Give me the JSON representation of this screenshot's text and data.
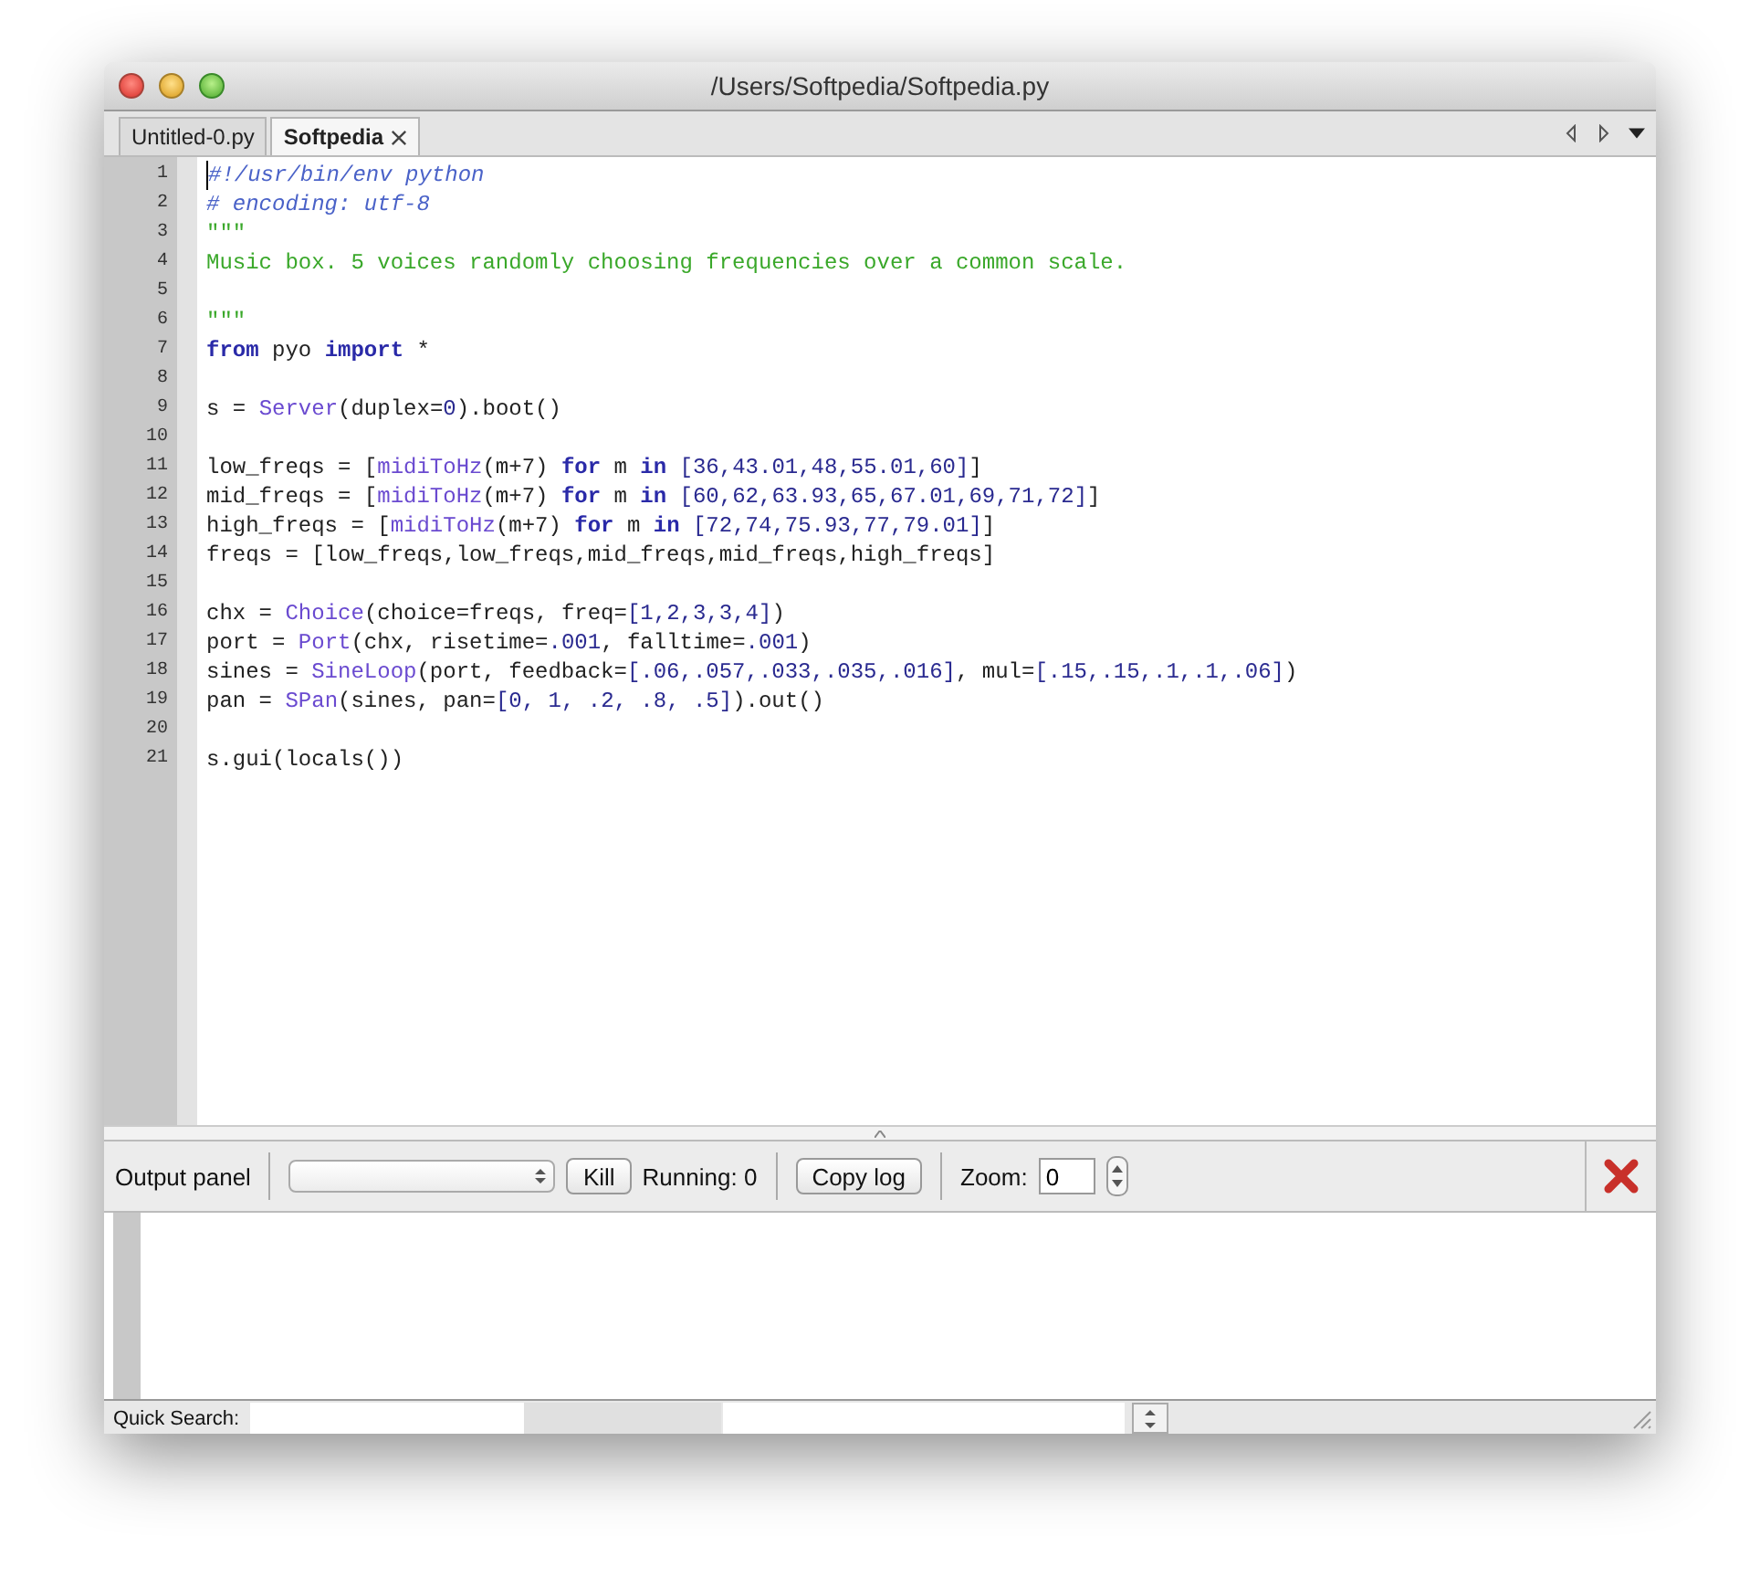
{
  "window": {
    "title": "/Users/Softpedia/Softpedia.py"
  },
  "tabs": [
    {
      "label": "Untitled-0.py",
      "selected": false,
      "closable": false
    },
    {
      "label": "Softpedia",
      "selected": true,
      "closable": true
    }
  ],
  "editor": {
    "lines": [
      {
        "number": "1",
        "tokens": [
          {
            "kind": "comment",
            "text": "#!/usr/bin/env python"
          }
        ]
      },
      {
        "number": "2",
        "tokens": [
          {
            "kind": "comment",
            "text": "# encoding: utf-8"
          }
        ]
      },
      {
        "number": "3",
        "tokens": [
          {
            "kind": "string",
            "text": "\"\"\""
          }
        ]
      },
      {
        "number": "4",
        "tokens": [
          {
            "kind": "string",
            "text": "Music box. 5 voices randomly choosing frequencies over a common scale."
          }
        ]
      },
      {
        "number": "5"
      },
      {
        "number": "6",
        "tokens": [
          {
            "kind": "string",
            "text": "\"\"\""
          }
        ]
      },
      {
        "number": "7",
        "tokens": [
          {
            "kind": "keyword",
            "text": "from"
          },
          {
            "kind": "plain",
            "text": " pyo "
          },
          {
            "kind": "keyword",
            "text": "import"
          },
          {
            "kind": "plain",
            "text": " *"
          }
        ]
      },
      {
        "number": "8"
      },
      {
        "number": "9",
        "tokens": [
          {
            "kind": "plain",
            "text": "s = "
          },
          {
            "kind": "builtin",
            "text": "Server"
          },
          {
            "kind": "plain",
            "text": "(duplex="
          },
          {
            "kind": "number",
            "text": "0"
          },
          {
            "kind": "plain",
            "text": ").boot()"
          }
        ]
      },
      {
        "number": "10"
      },
      {
        "number": "11",
        "tokens": [
          {
            "kind": "plain",
            "text": "low_freqs = ["
          },
          {
            "kind": "builtin",
            "text": "midiToHz"
          },
          {
            "kind": "plain",
            "text": "(m+7) "
          },
          {
            "kind": "keyword",
            "text": "for"
          },
          {
            "kind": "plain",
            "text": " m "
          },
          {
            "kind": "keyword",
            "text": "in"
          },
          {
            "kind": "number",
            "text": " [36,43.01,48,55.01,60]"
          },
          {
            "kind": "plain",
            "text": "]"
          }
        ]
      },
      {
        "number": "12",
        "tokens": [
          {
            "kind": "plain",
            "text": "mid_freqs = ["
          },
          {
            "kind": "builtin",
            "text": "midiToHz"
          },
          {
            "kind": "plain",
            "text": "(m+7) "
          },
          {
            "kind": "keyword",
            "text": "for"
          },
          {
            "kind": "plain",
            "text": " m "
          },
          {
            "kind": "keyword",
            "text": "in"
          },
          {
            "kind": "number",
            "text": " [60,62,63.93,65,67.01,69,71,72]"
          },
          {
            "kind": "plain",
            "text": "]"
          }
        ]
      },
      {
        "number": "13",
        "tokens": [
          {
            "kind": "plain",
            "text": "high_freqs = ["
          },
          {
            "kind": "builtin",
            "text": "midiToHz"
          },
          {
            "kind": "plain",
            "text": "(m+7) "
          },
          {
            "kind": "keyword",
            "text": "for"
          },
          {
            "kind": "plain",
            "text": " m "
          },
          {
            "kind": "keyword",
            "text": "in"
          },
          {
            "kind": "number",
            "text": " [72,74,75.93,77,79.01]"
          },
          {
            "kind": "plain",
            "text": "]"
          }
        ]
      },
      {
        "number": "14",
        "tokens": [
          {
            "kind": "plain",
            "text": "freqs = [low_freqs,low_freqs,mid_freqs,mid_freqs,high_freqs]"
          }
        ]
      },
      {
        "number": "15"
      },
      {
        "number": "16",
        "tokens": [
          {
            "kind": "plain",
            "text": "chx = "
          },
          {
            "kind": "builtin",
            "text": "Choice"
          },
          {
            "kind": "plain",
            "text": "(choice=freqs, freq="
          },
          {
            "kind": "number",
            "text": "[1,2,3,3,4]"
          },
          {
            "kind": "plain",
            "text": ")"
          }
        ]
      },
      {
        "number": "17",
        "tokens": [
          {
            "kind": "plain",
            "text": "port = "
          },
          {
            "kind": "builtin",
            "text": "Port"
          },
          {
            "kind": "plain",
            "text": "(chx, risetime="
          },
          {
            "kind": "number",
            "text": ".001"
          },
          {
            "kind": "plain",
            "text": ", falltime="
          },
          {
            "kind": "number",
            "text": ".001"
          },
          {
            "kind": "plain",
            "text": ")"
          }
        ]
      },
      {
        "number": "18",
        "tokens": [
          {
            "kind": "plain",
            "text": "sines = "
          },
          {
            "kind": "builtin",
            "text": "SineLoop"
          },
          {
            "kind": "plain",
            "text": "(port, feedback="
          },
          {
            "kind": "number",
            "text": "[.06,.057,.033,.035,.016]"
          },
          {
            "kind": "plain",
            "text": ", mul="
          },
          {
            "kind": "number",
            "text": "[.15,.15,.1,.1,.06]"
          },
          {
            "kind": "plain",
            "text": ")"
          }
        ]
      },
      {
        "number": "19",
        "tokens": [
          {
            "kind": "plain",
            "text": "pan = "
          },
          {
            "kind": "builtin",
            "text": "SPan"
          },
          {
            "kind": "plain",
            "text": "(sines, pan="
          },
          {
            "kind": "number",
            "text": "[0, 1, .2, .8, .5]"
          },
          {
            "kind": "plain",
            "text": ").out()"
          }
        ]
      },
      {
        "number": "20"
      },
      {
        "number": "21",
        "tokens": [
          {
            "kind": "plain",
            "text": "s.gui(locals())"
          }
        ]
      }
    ]
  },
  "output_panel": {
    "label": "Output panel",
    "kill_button": "Kill",
    "running": "Running: 0",
    "copy_button": "Copy log",
    "zoom_label": "Zoom:",
    "zoom_value": "0"
  },
  "quick_search": {
    "label": "Quick Search:"
  }
}
